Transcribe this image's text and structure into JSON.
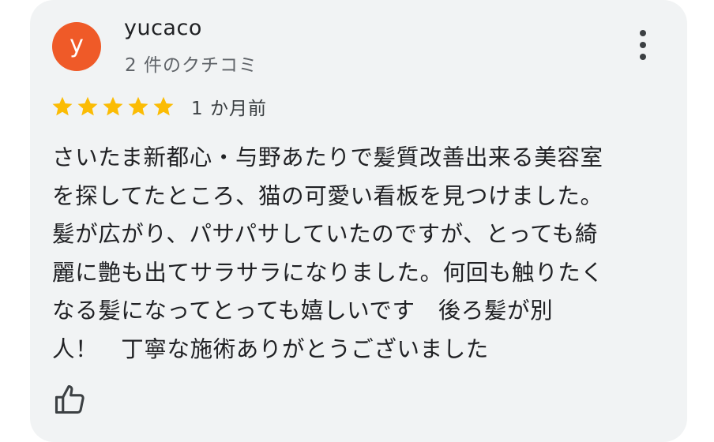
{
  "review": {
    "avatar_letter": "y",
    "avatar_color": "#ef5a28",
    "reviewer_name": "yucaco",
    "review_count": "2 件のクチコミ",
    "rating": 5,
    "star_color": "#fbbc04",
    "time_ago": "1 か月前",
    "text_lines": [
      "さいたま新都心・与野あたりで髪質改善出来る美容室",
      "を探してたところ、猫の可愛い看板を見つけました。",
      "髪が広がり、パサパサしていたのですが、とっても綺",
      "麗に艶も出てサラサラになりました。何回も触りたく",
      "なる髪になってとっても嬉しいです　後ろ髪が別",
      "人！　丁寧な施術ありがとうございました"
    ]
  },
  "icons": {
    "more": "more-vert-icon",
    "star": "star-icon",
    "like": "thumb-up-icon"
  }
}
